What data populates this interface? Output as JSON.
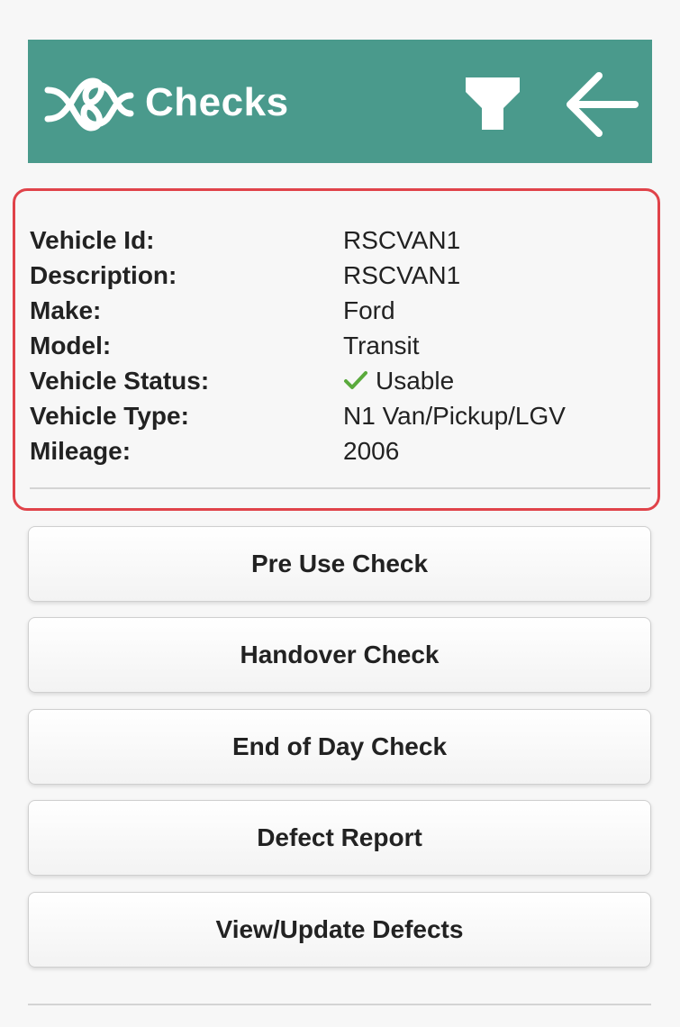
{
  "header": {
    "title": "Checks",
    "color": "#4a9a8c"
  },
  "vehicle": {
    "rows": [
      {
        "label": "Vehicle Id:",
        "value": "RSCVAN1"
      },
      {
        "label": "Description:",
        "value": "RSCVAN1"
      },
      {
        "label": "Make:",
        "value": "Ford"
      },
      {
        "label": "Model:",
        "value": "Transit"
      },
      {
        "label": "Vehicle Status:",
        "value": "Usable"
      },
      {
        "label": "Vehicle Type:",
        "value": "N1 Van/Pickup/LGV"
      },
      {
        "label": "Mileage:",
        "value": "2006"
      }
    ],
    "highlight_color": "#e0434a",
    "status_icon": "check-icon",
    "status_color": "#5aaa3c"
  },
  "actions": [
    {
      "label": "Pre Use Check"
    },
    {
      "label": "Handover Check"
    },
    {
      "label": "End of Day Check"
    },
    {
      "label": "Defect Report"
    },
    {
      "label": "View/Update Defects"
    }
  ],
  "icons": {
    "logo": "logo-icon",
    "filter": "filter-icon",
    "back": "back-arrow-icon"
  }
}
